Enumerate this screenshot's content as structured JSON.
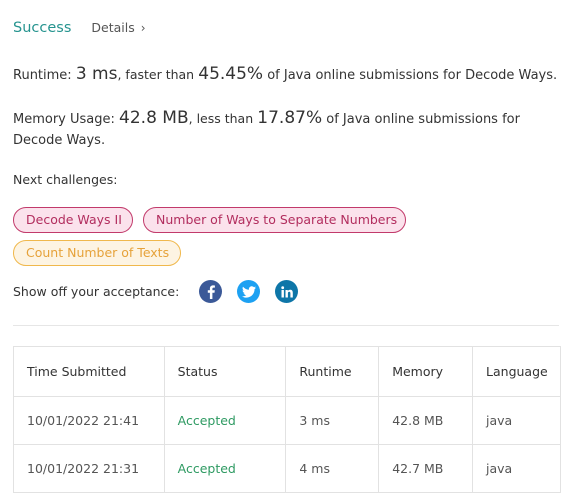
{
  "header": {
    "status": "Success",
    "details_label": "Details",
    "chevron": "›"
  },
  "runtime": {
    "label": "Runtime:",
    "value": "3 ms",
    "comparison": ", faster than",
    "percent": "45.45%",
    "suffix": "of Java online submissions for Decode Ways."
  },
  "memory": {
    "label": "Memory Usage:",
    "value": "42.8 MB",
    "comparison": ", less than",
    "percent": "17.87%",
    "suffix": "of Java online submissions for Decode Ways."
  },
  "next_challenges": {
    "label": "Next challenges:",
    "items": [
      {
        "label": "Decode Ways II",
        "difficulty": "hard"
      },
      {
        "label": "Number of Ways to Separate Numbers",
        "difficulty": "hard"
      },
      {
        "label": "Count Number of Texts",
        "difficulty": "medium"
      }
    ]
  },
  "share": {
    "label": "Show off your acceptance:",
    "icons": [
      "facebook-icon",
      "twitter-icon",
      "linkedin-icon"
    ]
  },
  "colors": {
    "success": "#26948f",
    "accepted": "#2e9a62",
    "hard_chip_bg": "#fbe2ec",
    "hard_chip_text": "#b22d5e",
    "medium_chip_bg": "#fdf4e3",
    "medium_chip_text": "#e6a23a",
    "facebook": "#3b5998",
    "twitter": "#1da1f2",
    "linkedin": "#0e76a8"
  },
  "submissions": {
    "columns": [
      "Time Submitted",
      "Status",
      "Runtime",
      "Memory",
      "Language"
    ],
    "rows": [
      {
        "time": "10/01/2022 21:41",
        "status": "Accepted",
        "runtime": "3 ms",
        "memory": "42.8 MB",
        "language": "java"
      },
      {
        "time": "10/01/2022 21:31",
        "status": "Accepted",
        "runtime": "4 ms",
        "memory": "42.7 MB",
        "language": "java"
      }
    ]
  }
}
